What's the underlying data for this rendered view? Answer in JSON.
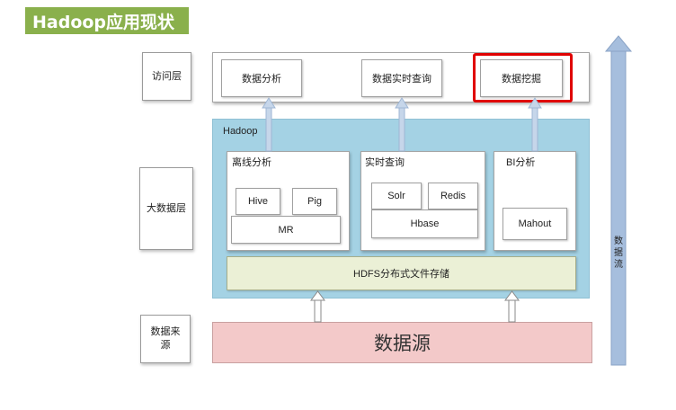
{
  "title": "Hadoop应用现状",
  "layers": {
    "access": "访问层",
    "bigdata": "大数据层",
    "source_top": "数据来",
    "source_bottom": "源"
  },
  "access_items": [
    "数据分析",
    "数据实时查询",
    "数据挖掘"
  ],
  "hadoop": {
    "title": "Hadoop",
    "offline": {
      "title": "离线分析",
      "items": [
        "Hive",
        "Pig",
        "MR"
      ]
    },
    "realtime": {
      "title": "实时查询",
      "items": [
        "Solr",
        "Redis",
        "Hbase"
      ]
    },
    "bi": {
      "title": "BI分析",
      "items": [
        "Mahout"
      ]
    },
    "hdfs": "HDFS分布式文件存储"
  },
  "datasource": "数据源",
  "flow": [
    "数",
    "据",
    "流"
  ],
  "colors": {
    "title_bg": "#8ab04c",
    "hadoop_panel": "#a4d2e4",
    "hdfs_bg": "#ebf0d6",
    "datasource_bg": "#f3c9c9",
    "arrow": "#a6bedd",
    "highlight": "#e00000"
  }
}
